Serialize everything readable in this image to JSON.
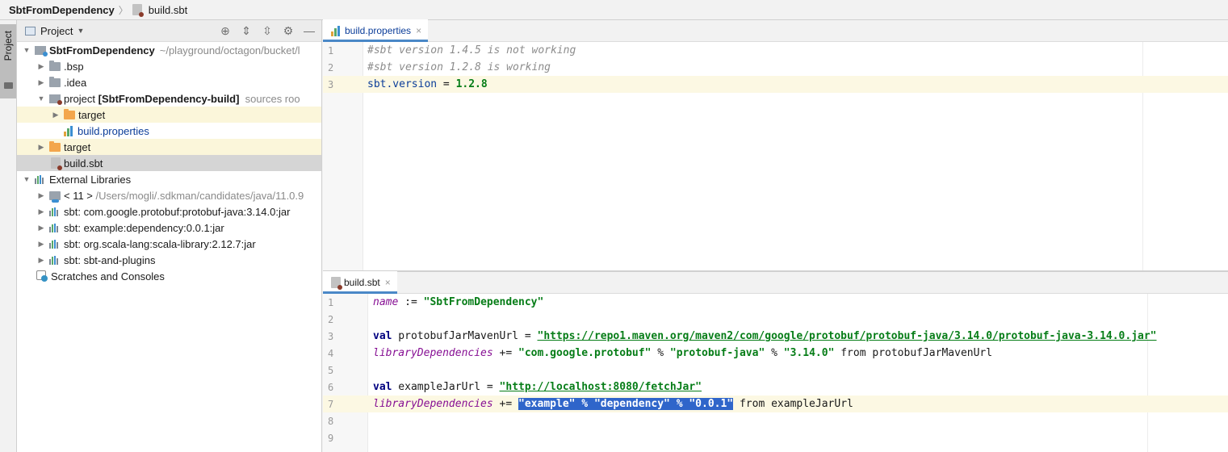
{
  "breadcrumb": {
    "root": "SbtFromDependency",
    "file": "build.sbt"
  },
  "tool_stripe": {
    "project_tab": "Project"
  },
  "project_panel": {
    "title": "Project",
    "tree": [
      {
        "label": "SbtFromDependency",
        "extra": "~/playground/octagon/bucket/l",
        "level": 0,
        "expanded": true
      },
      {
        "label": ".bsp",
        "level": 1
      },
      {
        "label": ".idea",
        "level": 1
      },
      {
        "label": "project",
        "bold_part": "[SbtFromDependency-build]",
        "extra": "sources roo",
        "level": 1,
        "expanded": true
      },
      {
        "label": "target",
        "level": 2
      },
      {
        "label": "build.properties",
        "level": 2
      },
      {
        "label": "target",
        "level": 1
      },
      {
        "label": "build.sbt",
        "level": 1
      },
      {
        "label": "External Libraries",
        "level": 0,
        "expanded": true
      },
      {
        "label": "< 11 >",
        "extra": "/Users/mogli/.sdkman/candidates/java/11.0.9",
        "level": 1
      },
      {
        "label": "sbt: com.google.protobuf:protobuf-java:3.14.0:jar",
        "level": 1
      },
      {
        "label": "sbt: example:dependency:0.0.1:jar",
        "level": 1
      },
      {
        "label": "sbt: org.scala-lang:scala-library:2.12.7:jar",
        "level": 1
      },
      {
        "label": "sbt: sbt-and-plugins",
        "level": 1
      },
      {
        "label": "Scratches and Consoles",
        "level": 0
      }
    ]
  },
  "editor_top": {
    "tab": "build.properties",
    "lines": [
      {
        "n": "1",
        "text": "#sbt version 1.4.5 is not working"
      },
      {
        "n": "2",
        "text": "#sbt version 1.2.8 is working"
      },
      {
        "n": "3",
        "key": "sbt.version",
        "eq": " = ",
        "val": "1.2.8"
      }
    ]
  },
  "editor_bottom": {
    "tab": "build.sbt",
    "lines": [
      {
        "n": "1",
        "a": "name",
        "b": " := ",
        "c": "\"SbtFromDependency\""
      },
      {
        "n": "2"
      },
      {
        "n": "3",
        "a": "val",
        "b": " protobufJarMavenUrl = ",
        "c": "\"https://repo1.maven.org/maven2/com/google/protobuf/protobuf-java/3.14.0/protobuf-java-3.14.0.jar\""
      },
      {
        "n": "4",
        "a": "libraryDependencies",
        "b": " += ",
        "c": "\"com.google.protobuf\"",
        "d": " % ",
        "e": "\"protobuf-java\"",
        "f": " % ",
        "g": "\"3.14.0\"",
        "h": " from protobufJarMavenUrl"
      },
      {
        "n": "5"
      },
      {
        "n": "6",
        "a": "val",
        "b": " exampleJarUrl = ",
        "c": "\"http://localhost:8080/fetchJar\""
      },
      {
        "n": "7",
        "a": "libraryDependencies",
        "b": " += ",
        "sel": "\"example\" % \"dependency\" % \"0.0.1\"",
        "h": " from exampleJarUrl"
      },
      {
        "n": "8"
      },
      {
        "n": "9"
      }
    ]
  }
}
